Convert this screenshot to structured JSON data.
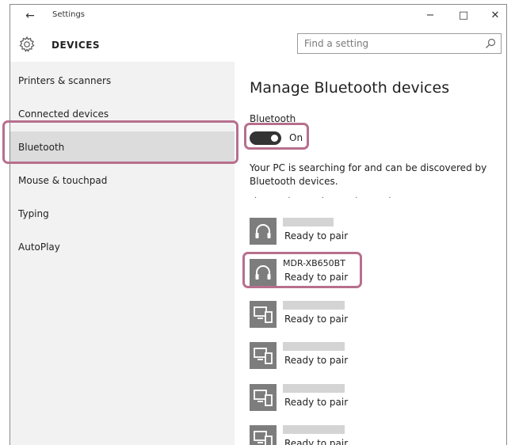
{
  "window": {
    "title": "Settings",
    "back_glyph": "←",
    "minimize_glyph": "−",
    "maximize_glyph": "□",
    "close_glyph": "✕"
  },
  "header": {
    "title": "DEVICES",
    "icon": "gear-icon",
    "search_placeholder": "Find a setting"
  },
  "sidebar": {
    "items": [
      {
        "label": "Printers & scanners",
        "selected": false
      },
      {
        "label": "Connected devices",
        "selected": false
      },
      {
        "label": "Bluetooth",
        "selected": true
      },
      {
        "label": "Mouse & touchpad",
        "selected": false
      },
      {
        "label": "Typing",
        "selected": false
      },
      {
        "label": "AutoPlay",
        "selected": false
      }
    ]
  },
  "main": {
    "heading": "Manage Bluetooth devices",
    "bluetooth_label": "Bluetooth",
    "toggle_state": "On",
    "toggle_on": true,
    "status_text": "Your PC is searching for and can be discovered by Bluetooth devices.",
    "searching_dots": ". . . . .",
    "devices": [
      {
        "name": "",
        "status": "Ready to pair",
        "icon": "headphones-icon"
      },
      {
        "name": "MDR-XB650BT",
        "status": "Ready to pair",
        "icon": "headphones-icon"
      },
      {
        "name": "",
        "status": "Ready to pair",
        "icon": "computer-phone-icon"
      },
      {
        "name": "",
        "status": "Ready to pair",
        "icon": "computer-phone-icon"
      },
      {
        "name": "",
        "status": "Ready to pair",
        "icon": "computer-phone-icon"
      },
      {
        "name": "",
        "status": "Ready to pair",
        "icon": "computer-phone-icon"
      }
    ]
  },
  "colors": {
    "highlight": "#b76f8d",
    "selected_bg": "#dcdcdc",
    "sidebar_bg": "#f2f2f2",
    "icon_bg": "#7d7d7d"
  }
}
